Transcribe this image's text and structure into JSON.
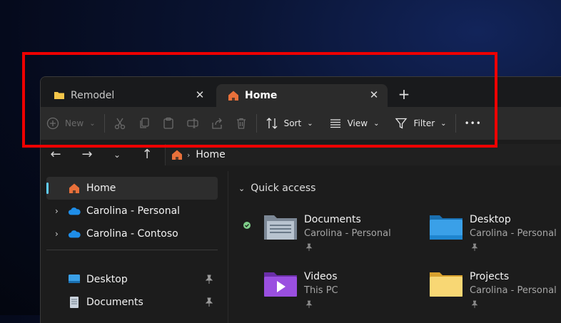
{
  "tabs": [
    {
      "label": "Remodel",
      "icon": "folder-icon",
      "active": false
    },
    {
      "label": "Home",
      "icon": "home-icon",
      "active": true
    }
  ],
  "toolbar": {
    "new_label": "New",
    "sort_label": "Sort",
    "view_label": "View",
    "filter_label": "Filter",
    "more_label": "•••"
  },
  "address": {
    "icon": "home-icon",
    "path": "Home"
  },
  "sidebar": {
    "items": [
      {
        "label": "Home",
        "icon": "home-icon"
      },
      {
        "label": "Carolina - Personal",
        "icon": "onedrive-icon"
      },
      {
        "label": "Carolina - Contoso",
        "icon": "onedrive-icon"
      },
      {
        "label": "Desktop",
        "icon": "desktop-icon"
      },
      {
        "label": "Documents",
        "icon": "documents-icon"
      }
    ]
  },
  "quick_access": {
    "title": "Quick access",
    "items": [
      {
        "name": "Documents",
        "location": "Carolina - Personal",
        "icon": "documents-folder-icon"
      },
      {
        "name": "Desktop",
        "location": "Carolina - Personal",
        "icon": "desktop-folder-icon"
      },
      {
        "name": "Videos",
        "location": "This PC",
        "icon": "videos-folder-icon"
      },
      {
        "name": "Projects",
        "location": "Carolina - Personal",
        "icon": "folder-icon"
      }
    ]
  },
  "colors": {
    "accent": "#60cdff",
    "highlight": "#ee0000",
    "folder": "#f3c64a"
  }
}
